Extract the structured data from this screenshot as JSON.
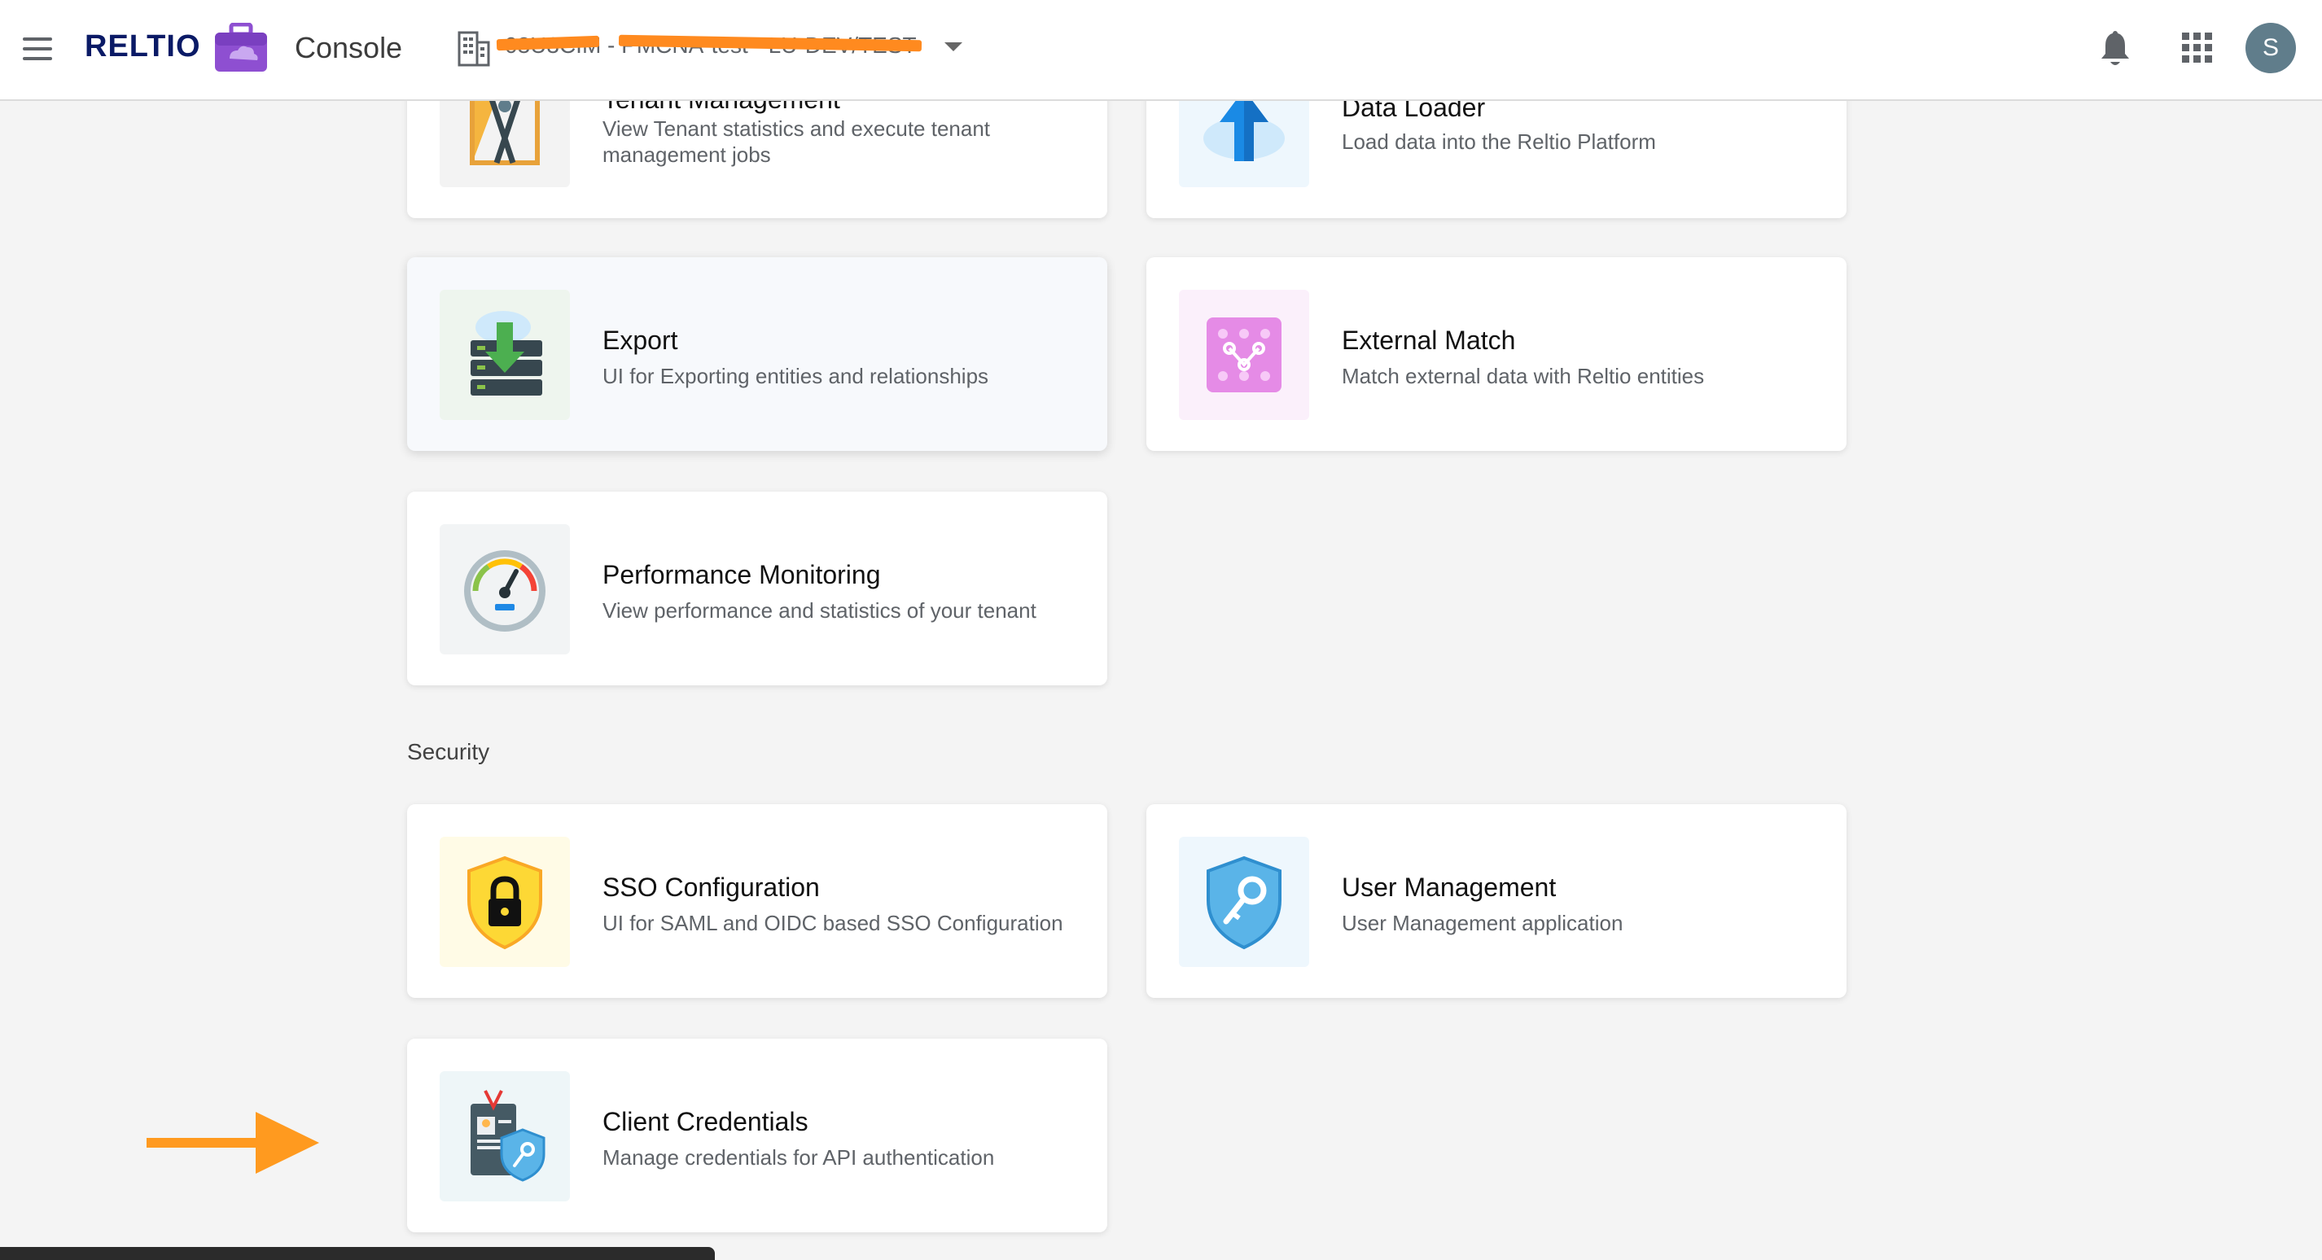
{
  "header": {
    "brand": "RELTIO",
    "app_label": "Console",
    "tenant_text": "03U3CIM - PMCNA-test - LU-DEV/TEST",
    "avatar_initial": "S",
    "redaction_color": "#ff8a1f"
  },
  "cards": {
    "tenant_management": {
      "title": "Tenant Management",
      "desc": "View Tenant statistics and execute tenant management jobs",
      "icon": "tools-icon"
    },
    "data_loader": {
      "title": "Data Loader",
      "desc": "Load data into the Reltio Platform",
      "icon": "upload-cloud-icon"
    },
    "export": {
      "title": "Export",
      "desc": "UI for Exporting entities and relationships",
      "icon": "export-server-icon"
    },
    "external_match": {
      "title": "External Match",
      "desc": "Match external data with Reltio entities",
      "icon": "match-grid-icon"
    },
    "performance_monitoring": {
      "title": "Performance Monitoring",
      "desc": "View performance and statistics of your tenant",
      "icon": "gauge-icon"
    },
    "sso_configuration": {
      "title": "SSO Configuration",
      "desc": "UI for SAML and OIDC based SSO Configuration",
      "icon": "shield-lock-icon"
    },
    "user_management": {
      "title": "User Management",
      "desc": "User Management application",
      "icon": "shield-key-icon"
    },
    "client_credentials": {
      "title": "Client Credentials",
      "desc": "Manage credentials for API authentication",
      "icon": "id-badge-key-icon"
    }
  },
  "sections": {
    "security": "Security"
  },
  "colors": {
    "brand_navy": "#0a1a66",
    "console_purple": "#8e4fd1",
    "annotation_arrow": "#ff9a1f",
    "avatar": "#607d8b"
  }
}
